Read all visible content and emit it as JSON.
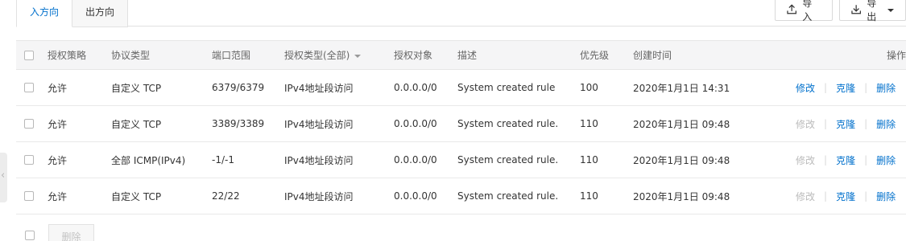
{
  "tabs": [
    {
      "label": "入方向",
      "active": true
    },
    {
      "label": "出方向",
      "active": false
    }
  ],
  "toolbar": {
    "import_label": "导入",
    "export_label": "导出"
  },
  "table": {
    "headers": {
      "policy": "授权策略",
      "protocol": "协议类型",
      "port": "端口范围",
      "auth_type": "授权类型(全部)",
      "object": "授权对象",
      "description": "描述",
      "priority": "优先级",
      "created": "创建时间",
      "ops": "操作"
    },
    "rows": [
      {
        "policy": "允许",
        "protocol": "自定义 TCP",
        "port": "6379/6379",
        "auth_type": "IPv4地址段访问",
        "object": "0.0.0.0/0",
        "description": "System created rule",
        "priority": "100",
        "created": "2020年1月1日 14:31",
        "edit": "修改",
        "clone": "克隆",
        "delete": "删除"
      },
      {
        "policy": "允许",
        "protocol": "自定义 TCP",
        "port": "3389/3389",
        "auth_type": "IPv4地址段访问",
        "object": "0.0.0.0/0",
        "description": "System created rule.",
        "priority": "110",
        "created": "2020年1月1日 09:48",
        "edit": "修改",
        "clone": "克隆",
        "delete": "删除"
      },
      {
        "policy": "允许",
        "protocol": "全部 ICMP(IPv4)",
        "port": "-1/-1",
        "auth_type": "IPv4地址段访问",
        "object": "0.0.0.0/0",
        "description": "System created rule.",
        "priority": "110",
        "created": "2020年1月1日 09:48",
        "edit": "修改",
        "clone": "克隆",
        "delete": "删除"
      },
      {
        "policy": "允许",
        "protocol": "自定义 TCP",
        "port": "22/22",
        "auth_type": "IPv4地址段访问",
        "object": "0.0.0.0/0",
        "description": "System created rule.",
        "priority": "110",
        "created": "2020年1月1日 09:48",
        "edit": "修改",
        "clone": "克隆",
        "delete": "删除"
      }
    ]
  },
  "footer": {
    "delete_label": "删除"
  },
  "colors": {
    "link": "#0070cc",
    "disabled": "#bbbbbb",
    "header_bg": "#f5f5f6"
  }
}
